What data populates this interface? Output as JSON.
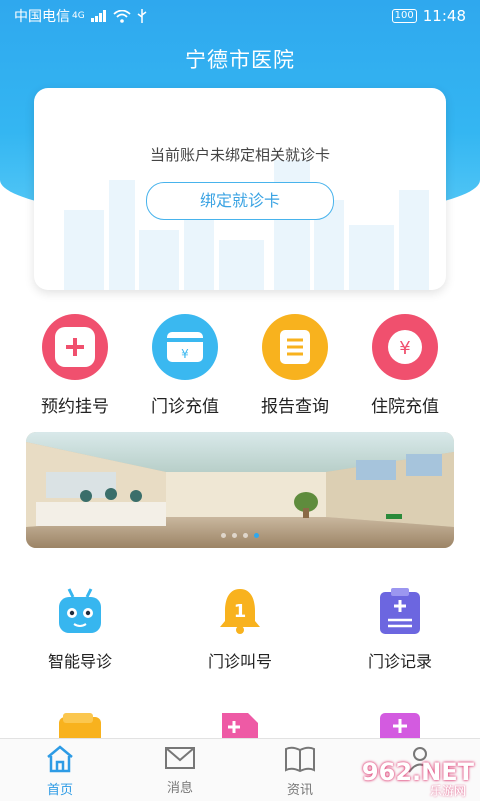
{
  "status": {
    "carrier": "中国电信",
    "network": "4G",
    "battery": "100",
    "time": "11:48"
  },
  "header": {
    "title": "宁德市医院"
  },
  "card": {
    "message": "当前账户未绑定相关就诊卡",
    "bind_label": "绑定就诊卡"
  },
  "quick_actions": [
    {
      "label": "预约挂号",
      "icon": "plus-icon",
      "color": "#f0506e"
    },
    {
      "label": "门诊充值",
      "icon": "card-yen-icon",
      "color": "#3ab8f0"
    },
    {
      "label": "报告查询",
      "icon": "report-icon",
      "color": "#f8b21e"
    },
    {
      "label": "住院充值",
      "icon": "yen-icon",
      "color": "#f0506e"
    }
  ],
  "banner": {
    "slides": 4,
    "active_slide": 3
  },
  "services": [
    {
      "label": "智能导诊",
      "icon": "robot-icon",
      "color": "#37b6ef"
    },
    {
      "label": "门诊叫号",
      "icon": "bell-icon",
      "color": "#f8b21e"
    },
    {
      "label": "门诊记录",
      "icon": "clipboard-icon",
      "color": "#6c66e0"
    },
    {
      "label": "",
      "icon": "wallet-icon",
      "color": "#f8b21e"
    },
    {
      "label": "",
      "icon": "document-plus-icon",
      "color": "#ee5aa5"
    },
    {
      "label": "",
      "icon": "medical-file-icon",
      "color": "#d35be0"
    }
  ],
  "tabs": [
    {
      "label": "首页",
      "icon": "home-icon",
      "active": true
    },
    {
      "label": "消息",
      "icon": "mail-icon",
      "active": false
    },
    {
      "label": "资讯",
      "icon": "book-icon",
      "active": false
    },
    {
      "label": "",
      "icon": "user-icon",
      "active": false
    }
  ],
  "watermark": {
    "text": "962.NET",
    "sub": "乐游网"
  },
  "colors": {
    "primary": "#2fa8ee",
    "bind_border": "#48b3ec"
  }
}
